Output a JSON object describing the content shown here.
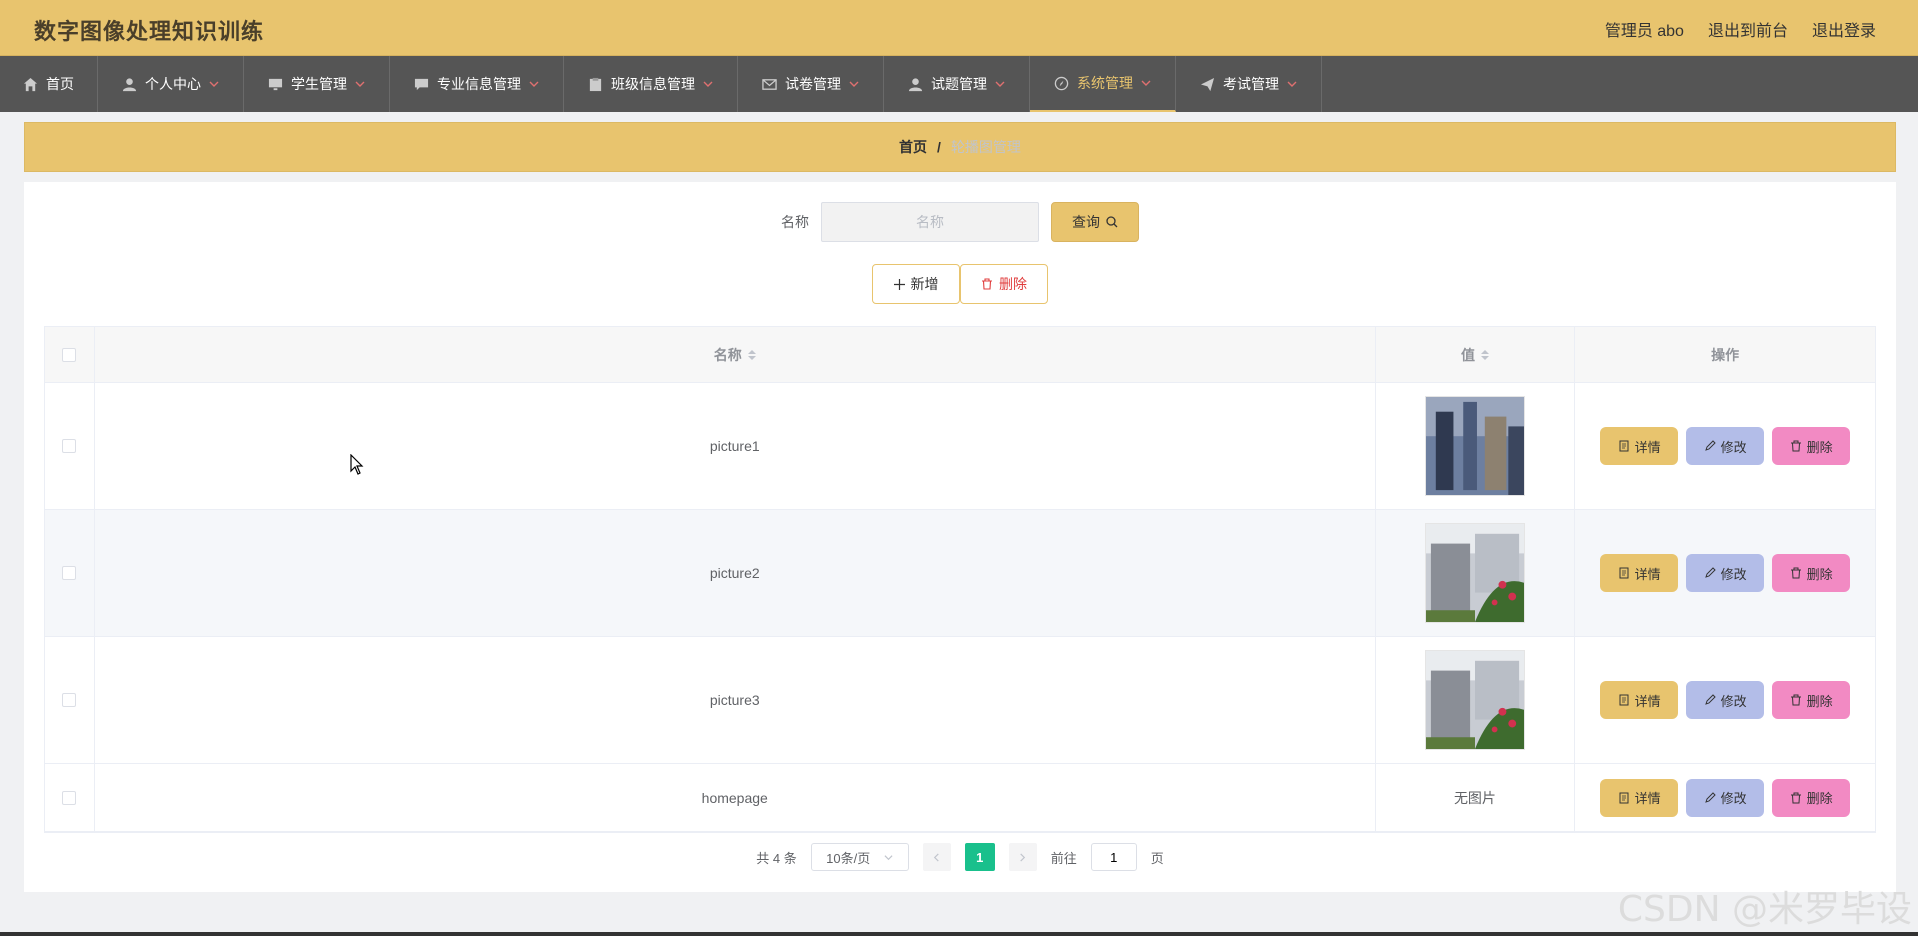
{
  "header": {
    "title": "数字图像处理知识训练",
    "user": "管理员 abo",
    "to_front": "退出到前台",
    "logout": "退出登录"
  },
  "nav": {
    "home": "首页",
    "personal": "个人中心",
    "students": "学生管理",
    "majors": "专业信息管理",
    "classes": "班级信息管理",
    "papers": "试卷管理",
    "questions": "试题管理",
    "system": "系统管理",
    "exams": "考试管理"
  },
  "breadcrumb": {
    "home": "首页",
    "sep": "/",
    "current": "轮播图管理"
  },
  "search": {
    "label": "名称",
    "placeholder": "名称",
    "button": "查询"
  },
  "actions": {
    "add": "新增",
    "delete": "删除"
  },
  "table": {
    "col_name": "名称",
    "col_value": "值",
    "col_op": "操作",
    "op_detail": "详情",
    "op_edit": "修改",
    "op_delete": "删除",
    "rows": [
      {
        "name": "picture1",
        "value": ""
      },
      {
        "name": "picture2",
        "value": ""
      },
      {
        "name": "picture3",
        "value": ""
      },
      {
        "name": "homepage",
        "value": "无图片"
      }
    ]
  },
  "pagination": {
    "total": "共 4 条",
    "page_size": "10条/页",
    "current_page": "1",
    "goto_label": "前往",
    "goto_value": "1",
    "page_suffix": "页"
  },
  "watermark": "CSDN @米罗毕设",
  "colors": {
    "accent": "#e8c46e",
    "nav_bg": "#555555",
    "edit_btn": "#b3bde8",
    "delete_btn": "#f28ac3",
    "pager_active": "#19c08c"
  }
}
